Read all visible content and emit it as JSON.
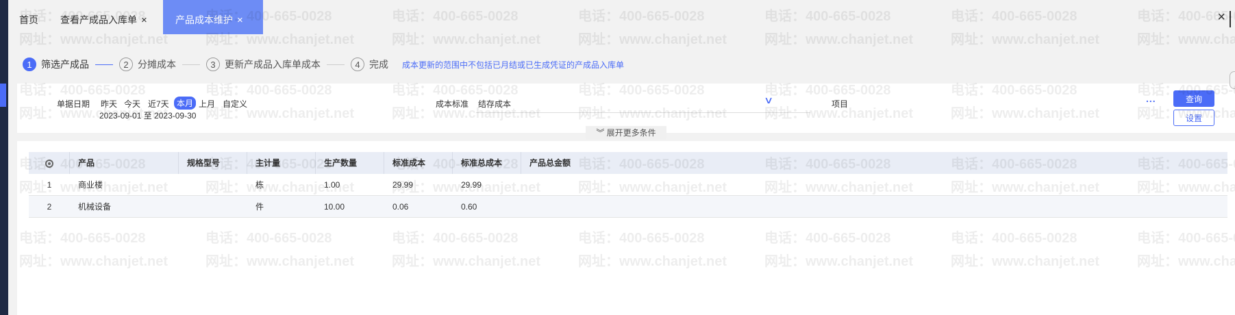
{
  "tabs": [
    {
      "label": "首页",
      "closable": false,
      "active": false
    },
    {
      "label": "查看产成品入库单",
      "closable": true,
      "active": false
    },
    {
      "label": "产品成本维护",
      "closable": true,
      "active": true
    }
  ],
  "close_symbol": "×",
  "steps": [
    {
      "num": "1",
      "label": "筛选产成品",
      "active": true
    },
    {
      "num": "2",
      "label": "分摊成本",
      "active": false
    },
    {
      "num": "3",
      "label": "更新产成品入库单成本",
      "active": false
    },
    {
      "num": "4",
      "label": "完成",
      "active": false
    }
  ],
  "steps_note": "成本更新的范围中不包括已月结或已生成凭证的产成品入库单",
  "filters": {
    "date_label": "单据日期",
    "date_options": [
      "昨天",
      "今天",
      "近7天",
      "本月",
      "上月",
      "自定义"
    ],
    "active_date_option": "本月",
    "date_range": "2023-09-01 至 2023-09-30",
    "cost_standard_label": "成本标准",
    "cost_standard_value": "结存成本",
    "project_label": "项目",
    "more_dots": "...",
    "query_label": "查询",
    "settings_label": "设置",
    "expand_label": "展开更多条件"
  },
  "table": {
    "columns": [
      "",
      "产品",
      "规格型号",
      "主计量",
      "生产数量",
      "标准成本",
      "标准总成本",
      "产品总金额"
    ],
    "rows": [
      [
        "1",
        "商业楼",
        "",
        "栋",
        "1.00",
        "29.99",
        "29.99",
        ""
      ],
      [
        "2",
        "机械设备",
        "",
        "件",
        "10.00",
        "0.06",
        "0.60",
        ""
      ]
    ]
  },
  "watermark": {
    "phone": "电话：400-665-0028",
    "site": "网址：www.chanjet.net"
  },
  "colors": {
    "accent": "#4b6cf7",
    "active_tab": "#6d8cf5",
    "left_rail": "#1f2a44"
  },
  "icons": {
    "settings_column": "gear-icon",
    "expand": "double-chevron-down-icon",
    "select_dropdown": "chevron-down-icon"
  }
}
